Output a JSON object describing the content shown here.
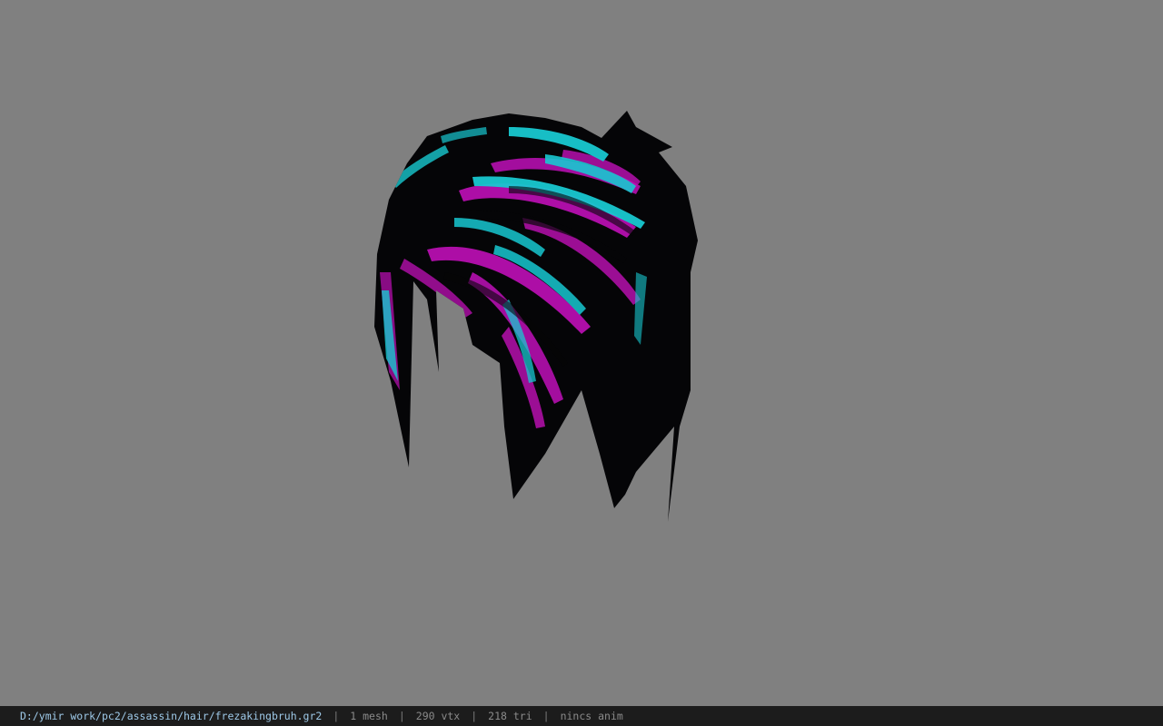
{
  "viewer": {
    "background_color": "#808080",
    "model_colors": {
      "base": "#050507",
      "accent_magenta": "#c010b8",
      "accent_cyan": "#18c8d0"
    }
  },
  "status_bar": {
    "file_path": "D:/ymir work/pc2/assassin/hair/frezakingbruh.gr2",
    "separator": "|",
    "mesh_count": "1 mesh",
    "vertex_count": "290 vtx",
    "triangle_count": "218 tri",
    "anim_status": "nincs anim"
  }
}
